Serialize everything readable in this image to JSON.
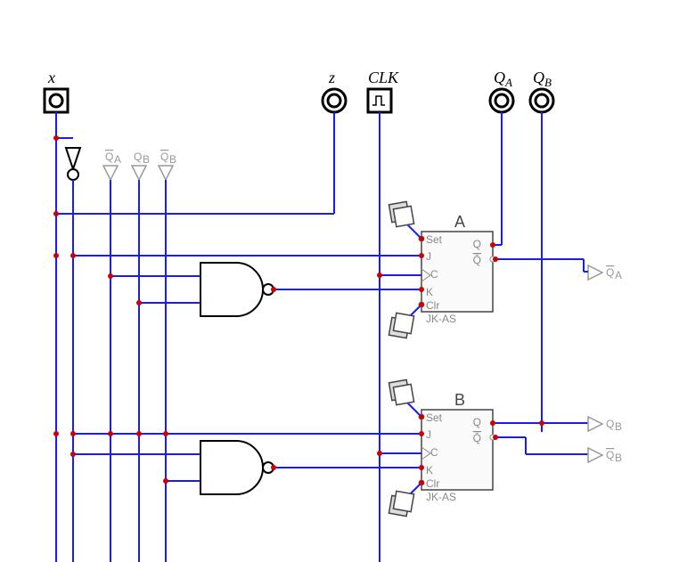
{
  "inputs": {
    "x_label": "x",
    "z_label": "z",
    "clk_label": "CLK",
    "qa_label": "QA",
    "qb_label": "QB"
  },
  "notgates": {
    "xbar": "x̄",
    "qa_bar": "Q̄A",
    "qb_bar": "Q̄B"
  },
  "flipflops": {
    "A": {
      "name": "A",
      "type": "JK-AS",
      "pins": {
        "set": "Set",
        "j": "J",
        "c": "C",
        "k": "K",
        "clr": "Clr",
        "q": "Q",
        "qbar": "Q̄"
      }
    },
    "B": {
      "name": "B",
      "type": "JK-AS",
      "pins": {
        "set": "Set",
        "j": "J",
        "c": "C",
        "k": "K",
        "clr": "Clr",
        "q": "Q",
        "qbar": "Q̄"
      }
    }
  },
  "out_labels": {
    "qa_bar": "Q̄A",
    "qb": "QB",
    "qb_bar": "Q̄B"
  },
  "grey_top": {
    "qa_bar": "Q̄A",
    "qb": "QB",
    "qb_bar": "Q̄B"
  },
  "chart_data": {
    "type": "logic-circuit",
    "inputs": [
      "x",
      "CLK"
    ],
    "outputs": [
      "z",
      "QA",
      "QB"
    ],
    "flip_flops": [
      {
        "id": "A",
        "type": "JK-AS",
        "J": "x̄",
        "K": "NAND(Q̄A,QB)",
        "C": "CLK",
        "Set": "switch",
        "Clr": "switch",
        "Q": "QA",
        "Qbar": "Q̄A"
      },
      {
        "id": "B",
        "type": "JK-AS",
        "J": "x̄",
        "K": "NAND(x̄,Q̄B)",
        "C": "CLK",
        "Set": "switch",
        "Clr": "switch",
        "Q": "QB",
        "Qbar": "Q̄B"
      }
    ],
    "gates": [
      {
        "id": "G1",
        "type": "NAND",
        "inputs": [
          "Q̄A",
          "QB"
        ],
        "output": "KA"
      },
      {
        "id": "G2",
        "type": "NAND",
        "inputs": [
          "x̄",
          "Q̄B"
        ],
        "output": "KB"
      }
    ],
    "z_connection": "x"
  }
}
